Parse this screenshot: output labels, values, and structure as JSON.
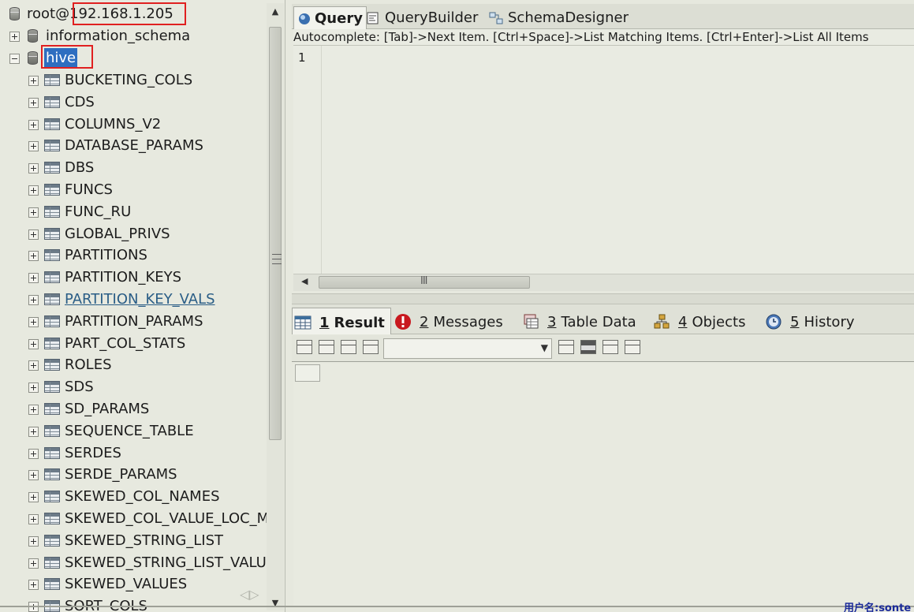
{
  "connection": {
    "user": "root@",
    "host": "192.168.1.205"
  },
  "databases": [
    {
      "name": "information_schema",
      "expanded": false
    },
    {
      "name": "hive",
      "expanded": true,
      "selected": true
    }
  ],
  "tables": [
    "BUCKETING_COLS",
    "CDS",
    "COLUMNS_V2",
    "DATABASE_PARAMS",
    "DBS",
    "FUNCS",
    "FUNC_RU",
    "GLOBAL_PRIVS",
    "PARTITIONS",
    "PARTITION_KEYS",
    "PARTITION_KEY_VALS",
    "PARTITION_PARAMS",
    "PART_COL_STATS",
    "ROLES",
    "SDS",
    "SD_PARAMS",
    "SEQUENCE_TABLE",
    "SERDES",
    "SERDE_PARAMS",
    "SKEWED_COL_NAMES",
    "SKEWED_COL_VALUE_LOC_M",
    "SKEWED_STRING_LIST",
    "SKEWED_STRING_LIST_VALU",
    "SKEWED_VALUES",
    "SORT_COLS"
  ],
  "hovered_table": "PARTITION_KEY_VALS",
  "editor": {
    "tabs": [
      "Query",
      "QueryBuilder",
      "SchemaDesigner"
    ],
    "active_tab": "Query",
    "autocomplete_hint": "Autocomplete: [Tab]->Next Item. [Ctrl+Space]->List Matching Items. [Ctrl+Enter]->List All Items",
    "line_number": "1",
    "scroll_grip": "III"
  },
  "result_tabs": [
    {
      "key": "1",
      "label": "Result",
      "icon": "grid-icon"
    },
    {
      "key": "2",
      "label": "Messages",
      "icon": "error-icon"
    },
    {
      "key": "3",
      "label": "Table Data",
      "icon": "table-data-icon"
    },
    {
      "key": "4",
      "label": "Objects",
      "icon": "objects-icon"
    },
    {
      "key": "5",
      "label": "History",
      "icon": "history-icon"
    }
  ],
  "status": {
    "user_label": "用户名:sonte"
  },
  "colors": {
    "selection": "#2e6ec0",
    "link": "#2a5d86",
    "highlight_box": "#e02020"
  }
}
